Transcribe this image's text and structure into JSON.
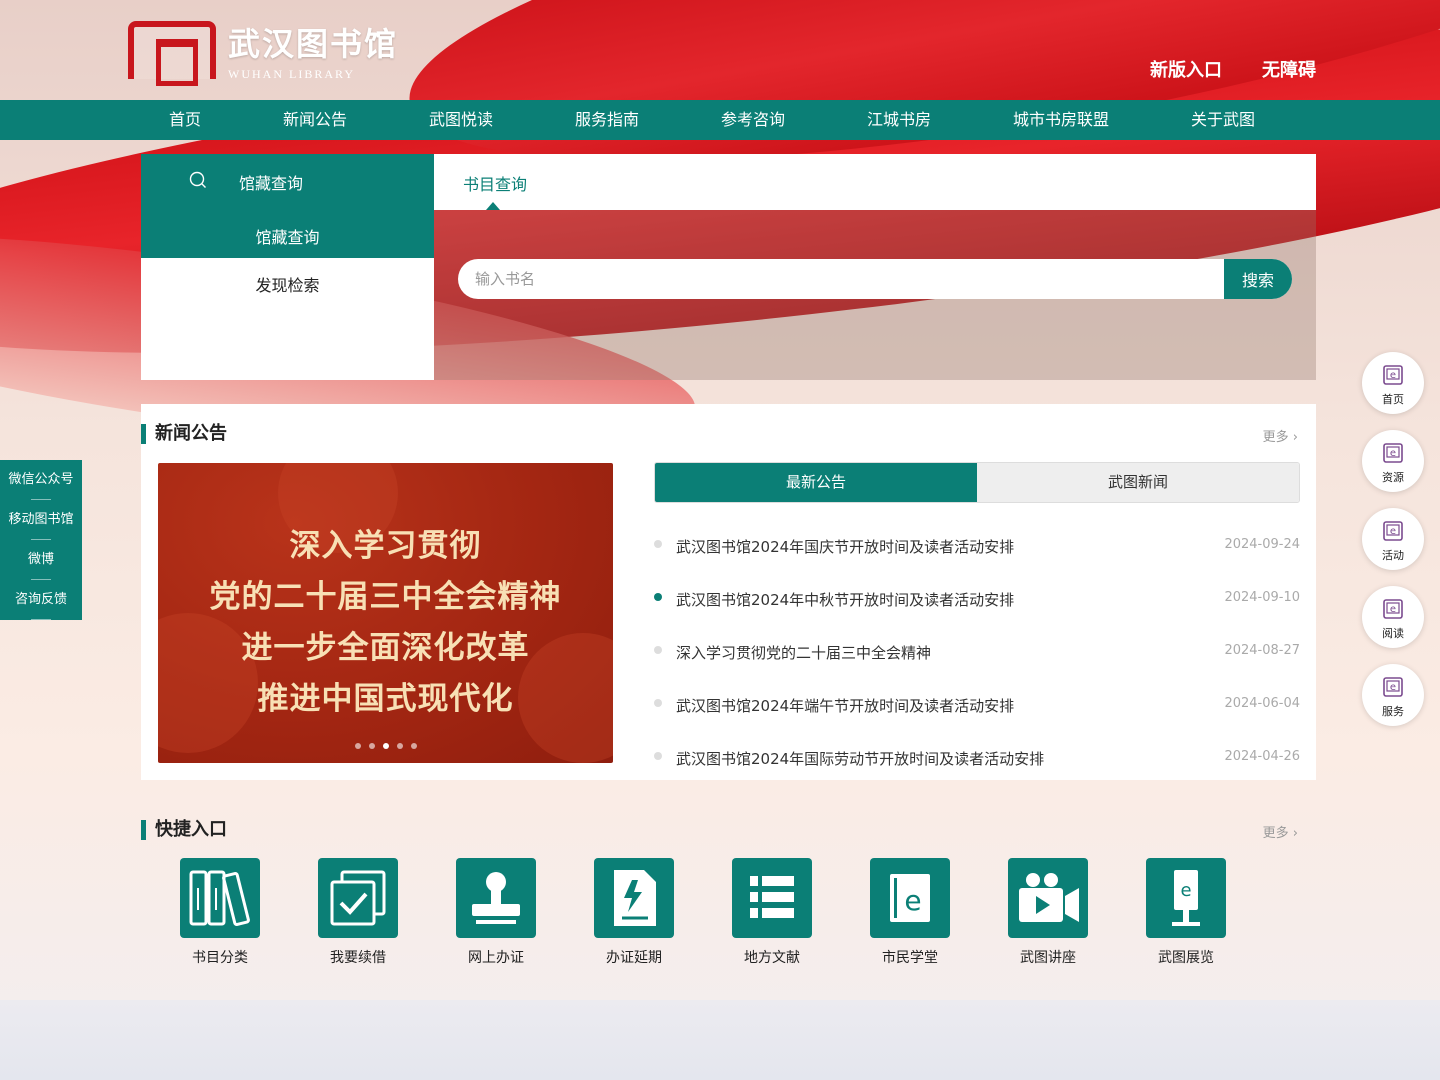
{
  "header": {
    "logo_cn": "武汉图书馆",
    "logo_en": "WUHAN LIBRARY",
    "links": [
      "新版入口",
      "无障碍"
    ]
  },
  "nav": [
    "首页",
    "新闻公告",
    "武图悦读",
    "服务指南",
    "参考咨询",
    "江城书房",
    "城市书房联盟",
    "关于武图"
  ],
  "search": {
    "panel_title": "馆藏查询",
    "options": [
      "馆藏查询",
      "发现检索"
    ],
    "tab": "书目查询",
    "placeholder": "输入书名",
    "button": "搜索"
  },
  "news": {
    "title": "新闻公告",
    "more": "更多",
    "banner_lines": [
      "深入学习贯彻",
      "党的二十届三中全会精神",
      "进一步全面深化改革",
      "推进中国式现代化"
    ],
    "banner_dots": 5,
    "banner_active_dot": 2,
    "tabs": [
      "最新公告",
      "武图新闻"
    ],
    "items": [
      {
        "title": "武汉图书馆2024年国庆节开放时间及读者活动安排",
        "date": "2024-09-24"
      },
      {
        "title": "武汉图书馆2024年中秋节开放时间及读者活动安排",
        "date": "2024-09-10"
      },
      {
        "title": "深入学习贯彻党的二十届三中全会精神",
        "date": "2024-08-27"
      },
      {
        "title": "武汉图书馆2024年端午节开放时间及读者活动安排",
        "date": "2024-06-04"
      },
      {
        "title": "武汉图书馆2024年国际劳动节开放时间及读者活动安排",
        "date": "2024-04-26"
      }
    ]
  },
  "quick": {
    "title": "快捷入口",
    "more": "更多",
    "items": [
      {
        "label": "书目分类",
        "icon": "books-icon"
      },
      {
        "label": "我要续借",
        "icon": "renew-check-icon"
      },
      {
        "label": "网上办证",
        "icon": "stamp-icon"
      },
      {
        "label": "办证延期",
        "icon": "document-bolt-icon"
      },
      {
        "label": "地方文献",
        "icon": "list-icon"
      },
      {
        "label": "市民学堂",
        "icon": "ebook-icon"
      },
      {
        "label": "武图讲座",
        "icon": "video-camera-icon"
      },
      {
        "label": "武图展览",
        "icon": "kiosk-icon"
      }
    ]
  },
  "left_float": [
    "微信公众号",
    "移动图书馆",
    "微博",
    "咨询反馈"
  ],
  "right_float": [
    "首页",
    "资源",
    "活动",
    "阅读",
    "服务"
  ],
  "colors": {
    "primary": "#0b7f76",
    "brand_red": "#c8161d"
  }
}
